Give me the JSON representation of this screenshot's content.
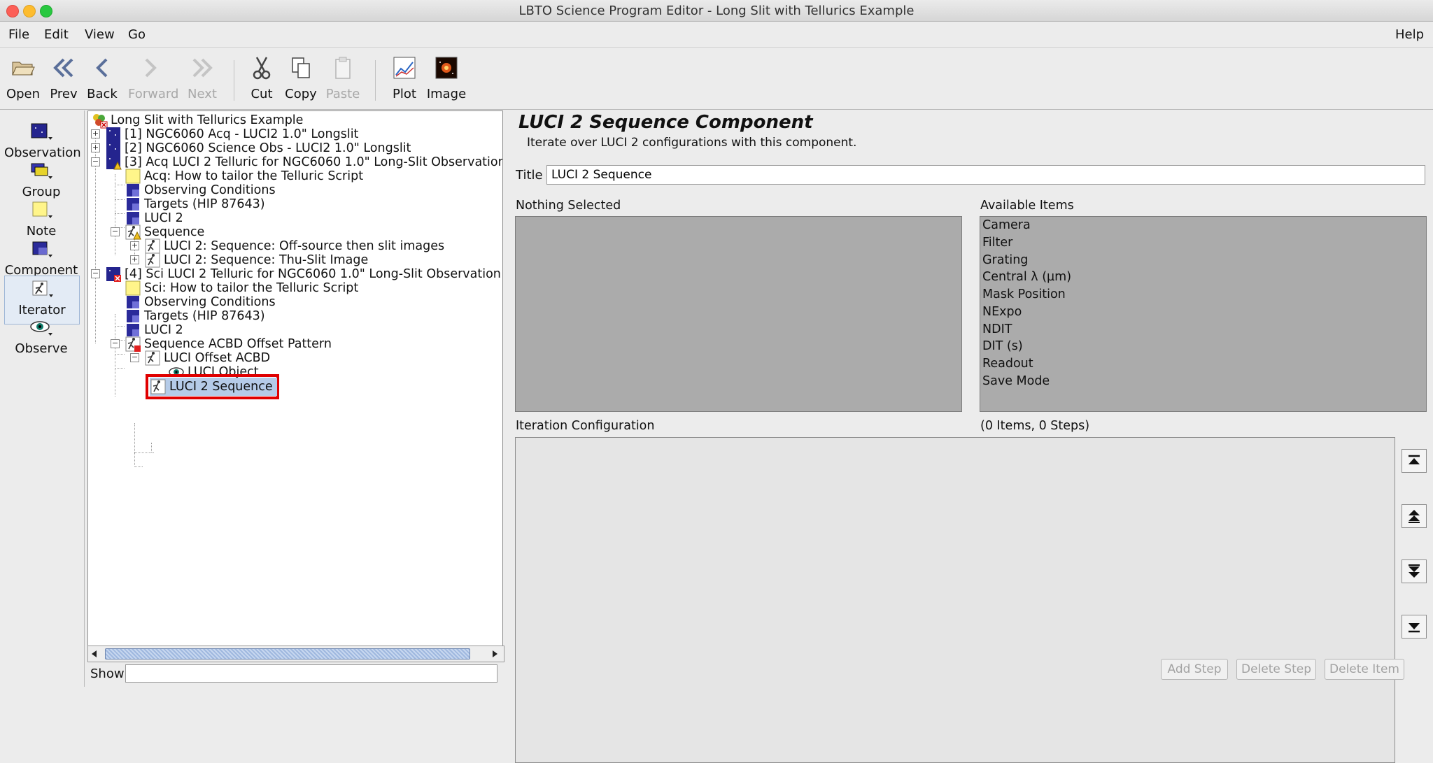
{
  "window": {
    "title": "LBTO Science Program Editor - Long Slit with Tellurics Example"
  },
  "menu": {
    "file": "File",
    "edit": "Edit",
    "view": "View",
    "go": "Go",
    "help": "Help"
  },
  "toolbar": {
    "open": "Open",
    "prev": "Prev",
    "back": "Back",
    "forward": "Forward",
    "next": "Next",
    "cut": "Cut",
    "copy": "Copy",
    "paste": "Paste",
    "plot": "Plot",
    "image": "Image"
  },
  "palette": {
    "observation": "Observation",
    "group": "Group",
    "note": "Note",
    "component": "Component",
    "iterator": "Iterator",
    "observe": "Observe"
  },
  "tree": {
    "root": "Long Slit with Tellurics Example",
    "n1": "[1] NGC6060 Acq - LUCI2 1.0\" Longslit",
    "n2": "[2] NGC6060 Science Obs - LUCI2 1.0\" Longslit",
    "n3": "[3] Acq LUCI 2 Telluric for NGC6060 1.0\" Long-Slit Observation",
    "n3_note": "Acq: How to tailor the Telluric Script",
    "n3_cond": "Observing Conditions",
    "n3_targets": "Targets (HIP 87643)",
    "n3_luci": "LUCI 2",
    "n3_seq": "Sequence",
    "n3_seq1": "LUCI 2: Sequence: Off-source then slit images",
    "n3_seq2": "LUCI 2: Sequence: Thu-Slit Image",
    "n4": "[4] Sci LUCI 2 Telluric for NGC6060 1.0\" Long-Slit Observation",
    "n4_note": "Sci: How to tailor the Telluric Script",
    "n4_cond": "Observing Conditions",
    "n4_targets": "Targets (HIP 87643)",
    "n4_luci": "LUCI 2",
    "n4_seq": "Sequence ACBD Offset Pattern",
    "n4_offset": "LUCI Offset ACBD",
    "n4_object": "LUCI Object",
    "n4_luciseq": "LUCI 2 Sequence"
  },
  "show": {
    "label": "Show",
    "value": ""
  },
  "editor": {
    "heading": "LUCI 2 Sequence Component",
    "description": "Iterate over LUCI 2 configurations with this component.",
    "title_label": "Title",
    "title_value": "LUCI 2 Sequence",
    "nothing_selected": "Nothing Selected",
    "available_label": "Available Items",
    "available_items": [
      "Camera",
      "Filter",
      "Grating",
      "Central λ (µm)",
      "Mask Position",
      "NExpo",
      "NDIT",
      "DIT (s)",
      "Readout",
      "Save Mode"
    ],
    "iteration_label": "Iteration Configuration",
    "iteration_count": "(0 Items, 0 Steps)",
    "add_step": "Add Step",
    "delete_step": "Delete Step",
    "delete_item": "Delete Item"
  },
  "colors": {
    "highlight": "#e00000",
    "selection": "#b5cbe8",
    "note_yellow": "#fff58a",
    "component_blue": "#2a2a9a"
  }
}
